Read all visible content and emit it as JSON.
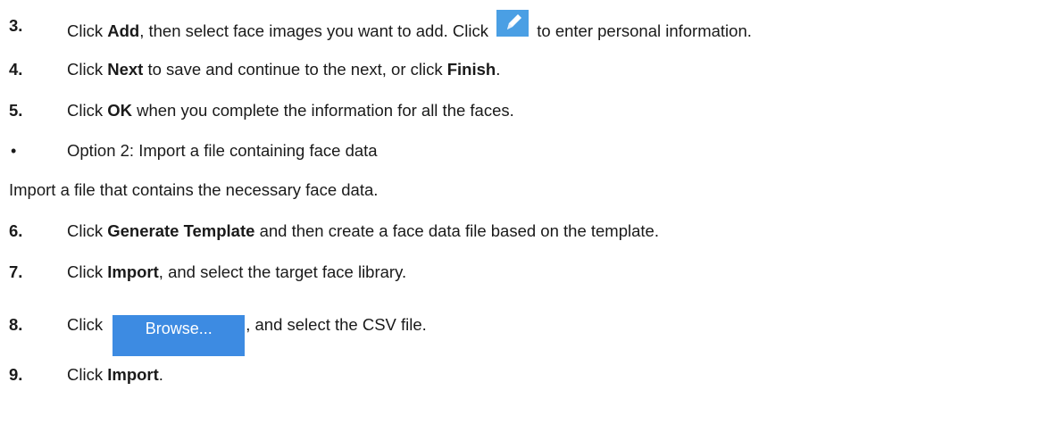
{
  "steps": [
    {
      "number": "3.",
      "parts": [
        "Click ",
        "Add",
        ", then select face images you want to add. Click ",
        " to enter personal information."
      ],
      "icon": "pencil-edit-icon"
    },
    {
      "number": "4.",
      "parts": [
        "Click ",
        "Next",
        " to save and continue to the next, or click ",
        "Finish",
        "."
      ]
    },
    {
      "number": "5.",
      "parts": [
        "Click ",
        "OK",
        " when you complete the information for all the faces."
      ]
    },
    {
      "bullet": "•",
      "text": "Option 2: Import a file containing face data"
    },
    {
      "text": "Import a file that contains the necessary face data."
    },
    {
      "number": "6.",
      "parts": [
        "Click ",
        "Generate Template",
        " and then create a face data file based on the template."
      ]
    },
    {
      "number": "7.",
      "parts": [
        "Click ",
        "Import",
        ", and select the target face library."
      ]
    },
    {
      "number": "8.",
      "parts": [
        "Click ",
        "Browse...",
        ", and select the CSV file."
      ]
    },
    {
      "number": "9.",
      "parts": [
        "Click ",
        "Import",
        "."
      ]
    }
  ],
  "colors": {
    "edit_button": "#4a9fe4",
    "browse_button": "#3d8be2"
  }
}
